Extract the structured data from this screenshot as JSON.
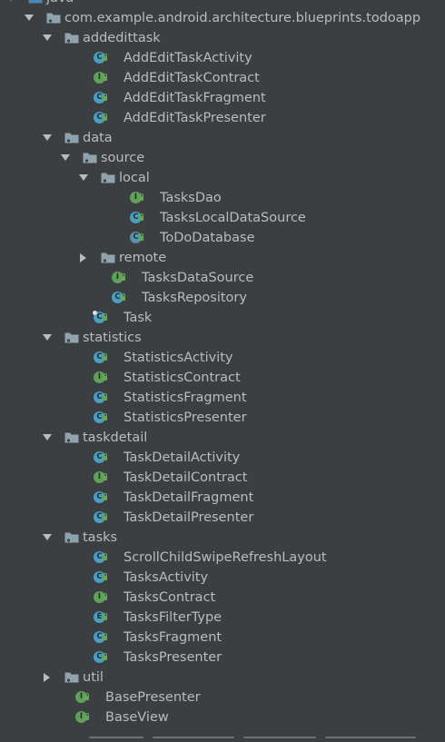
{
  "colors": {
    "background": "#3c3f41",
    "text": "#bbbbbb",
    "class_icon": "#4b9ec2",
    "interface_icon": "#5fa05a",
    "folder_icon": "#8fa3ae",
    "arrow": "#bbbbbb"
  },
  "tree": [
    {
      "label": "java",
      "kind": "folder",
      "depth": 0,
      "arrow": "expanded",
      "folder": "source-root"
    },
    {
      "label": "com.example.android.architecture.blueprints.todoapp",
      "kind": "folder",
      "depth": 1,
      "arrow": "expanded",
      "folder": "package"
    },
    {
      "label": "addedittask",
      "kind": "folder",
      "depth": 2,
      "arrow": "expanded",
      "folder": "package"
    },
    {
      "label": "AddEditTaskActivity",
      "kind": "class",
      "depth": 3,
      "letter": "C"
    },
    {
      "label": "AddEditTaskContract",
      "kind": "interface",
      "depth": 3,
      "letter": "I"
    },
    {
      "label": "AddEditTaskFragment",
      "kind": "class",
      "depth": 3,
      "letter": "C"
    },
    {
      "label": "AddEditTaskPresenter",
      "kind": "class",
      "depth": 3,
      "letter": "C"
    },
    {
      "label": "data",
      "kind": "folder",
      "depth": 2,
      "arrow": "expanded",
      "folder": "package"
    },
    {
      "label": "source",
      "kind": "folder",
      "depth": 3,
      "arrow": "expanded",
      "folder": "package"
    },
    {
      "label": "local",
      "kind": "folder",
      "depth": 4,
      "arrow": "expanded",
      "folder": "package"
    },
    {
      "label": "TasksDao",
      "kind": "interface",
      "depth": 5,
      "letter": "I"
    },
    {
      "label": "TasksLocalDataSource",
      "kind": "class",
      "depth": 5,
      "letter": "C"
    },
    {
      "label": "ToDoDatabase",
      "kind": "abstract",
      "depth": 5,
      "letter": "C"
    },
    {
      "label": "remote",
      "kind": "folder",
      "depth": 4,
      "arrow": "collapsed",
      "folder": "package"
    },
    {
      "label": "TasksDataSource",
      "kind": "interface",
      "depth": 4,
      "letter": "I"
    },
    {
      "label": "TasksRepository",
      "kind": "class",
      "depth": 4,
      "letter": "C"
    },
    {
      "label": "Task",
      "kind": "entity",
      "depth": 3,
      "letter": "C"
    },
    {
      "label": "statistics",
      "kind": "folder",
      "depth": 2,
      "arrow": "expanded",
      "folder": "package"
    },
    {
      "label": "StatisticsActivity",
      "kind": "class",
      "depth": 3,
      "letter": "C"
    },
    {
      "label": "StatisticsContract",
      "kind": "interface",
      "depth": 3,
      "letter": "I"
    },
    {
      "label": "StatisticsFragment",
      "kind": "class",
      "depth": 3,
      "letter": "C"
    },
    {
      "label": "StatisticsPresenter",
      "kind": "class",
      "depth": 3,
      "letter": "C"
    },
    {
      "label": "taskdetail",
      "kind": "folder",
      "depth": 2,
      "arrow": "expanded",
      "folder": "package"
    },
    {
      "label": "TaskDetailActivity",
      "kind": "class",
      "depth": 3,
      "letter": "C"
    },
    {
      "label": "TaskDetailContract",
      "kind": "interface",
      "depth": 3,
      "letter": "I"
    },
    {
      "label": "TaskDetailFragment",
      "kind": "class",
      "depth": 3,
      "letter": "C"
    },
    {
      "label": "TaskDetailPresenter",
      "kind": "class",
      "depth": 3,
      "letter": "C"
    },
    {
      "label": "tasks",
      "kind": "folder",
      "depth": 2,
      "arrow": "expanded",
      "folder": "package"
    },
    {
      "label": "ScrollChildSwipeRefreshLayout",
      "kind": "class",
      "depth": 3,
      "letter": "C"
    },
    {
      "label": "TasksActivity",
      "kind": "class",
      "depth": 3,
      "letter": "C"
    },
    {
      "label": "TasksContract",
      "kind": "interface",
      "depth": 3,
      "letter": "I"
    },
    {
      "label": "TasksFilterType",
      "kind": "enum",
      "depth": 3,
      "letter": "E"
    },
    {
      "label": "TasksFragment",
      "kind": "class",
      "depth": 3,
      "letter": "C"
    },
    {
      "label": "TasksPresenter",
      "kind": "class",
      "depth": 3,
      "letter": "C"
    },
    {
      "label": "util",
      "kind": "folder",
      "depth": 2,
      "arrow": "collapsed",
      "folder": "package"
    },
    {
      "label": "BasePresenter",
      "kind": "interface",
      "depth": 2,
      "letter": "I"
    },
    {
      "label": "BaseView",
      "kind": "interface",
      "depth": 2,
      "letter": "I"
    }
  ]
}
